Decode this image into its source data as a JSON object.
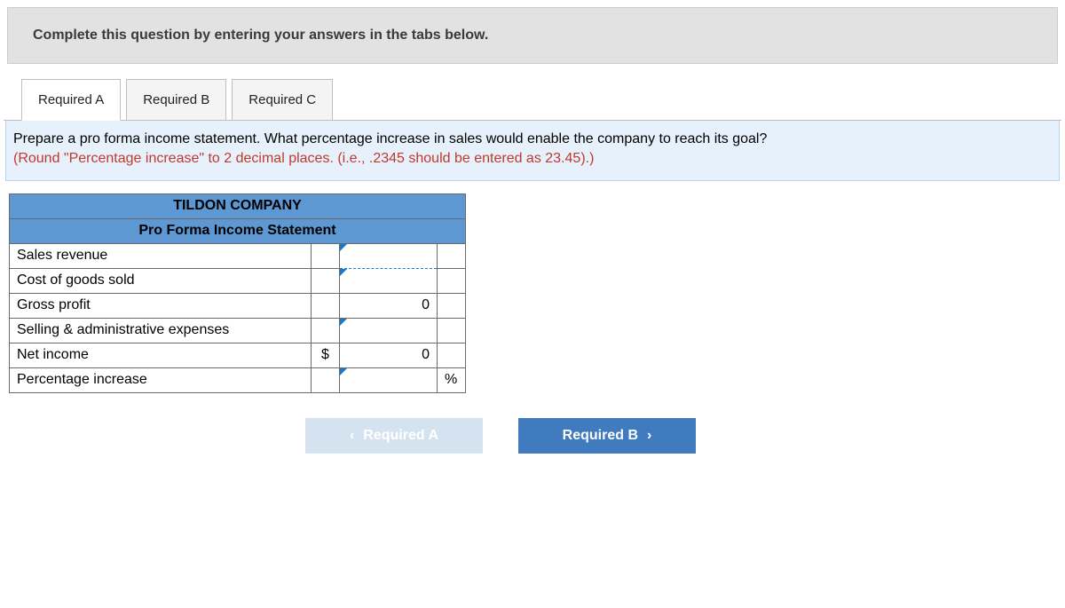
{
  "instruction": "Complete this question by entering your answers in the tabs below.",
  "tabs": [
    {
      "label": "Required A",
      "active": true
    },
    {
      "label": "Required B",
      "active": false
    },
    {
      "label": "Required C",
      "active": false
    }
  ],
  "prompt": {
    "main": "Prepare a pro forma income statement. What percentage increase in sales would enable the company to reach its goal?",
    "note": "(Round \"Percentage increase\" to 2 decimal places. (i.e., .2345 should be entered as 23.45).)"
  },
  "worksheet": {
    "company": "TILDON COMPANY",
    "title": "Pro Forma Income Statement",
    "rows": [
      {
        "label": "Sales revenue",
        "sym": "",
        "value": "",
        "unit": "",
        "editable": true,
        "calculated": false
      },
      {
        "label": "Cost of goods sold",
        "sym": "",
        "value": "",
        "unit": "",
        "editable": true,
        "calculated": false
      },
      {
        "label": "Gross profit",
        "sym": "",
        "value": "0",
        "unit": "",
        "editable": false,
        "calculated": true
      },
      {
        "label": "Selling & administrative expenses",
        "sym": "",
        "value": "",
        "unit": "",
        "editable": true,
        "calculated": false
      },
      {
        "label": "Net income",
        "sym": "$",
        "value": "0",
        "unit": "",
        "editable": false,
        "calculated": true
      },
      {
        "label": "Percentage increase",
        "sym": "",
        "value": "",
        "unit": "%",
        "editable": true,
        "calculated": false
      }
    ]
  },
  "nav": {
    "prev": "Required A",
    "next": "Required B"
  }
}
